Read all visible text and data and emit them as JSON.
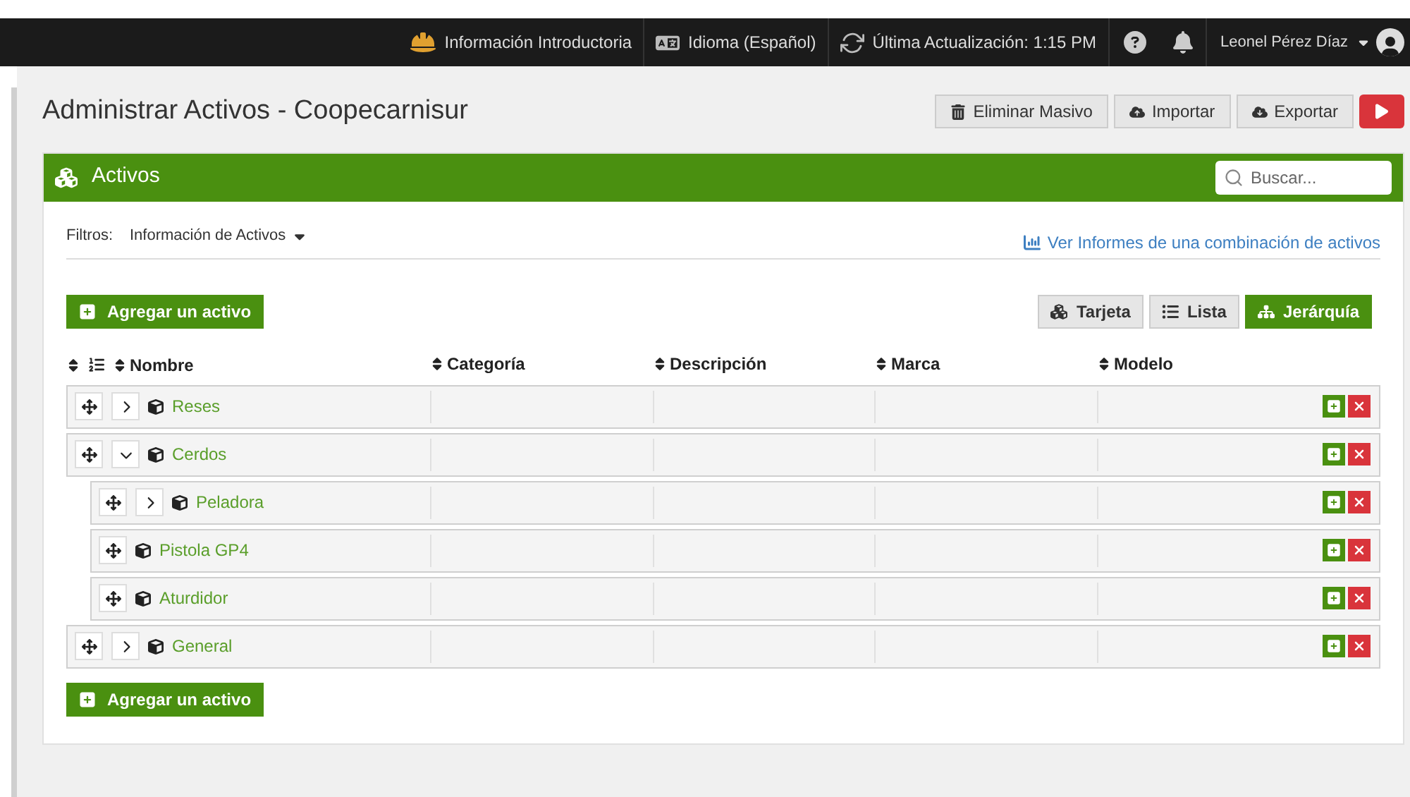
{
  "navbar": {
    "items": [
      "Información Introductoria",
      "Idioma (Español)",
      "Última Actualización: 1:15 PM"
    ],
    "user": "Leonel Pérez Díaz"
  },
  "page": {
    "title": "Administrar Activos - Coopecarnisur",
    "actions": [
      "Eliminar Masivo",
      "Importar",
      "Exportar"
    ]
  },
  "panel": {
    "title": "Activos",
    "search": {
      "placeholder": "Buscar..."
    },
    "filters": {
      "label": "Filtros:",
      "value": "Información de Activos"
    },
    "report_link": "Ver Informes de una combinación de activos",
    "add_button": "Agregar un activo",
    "views": [
      {
        "label": "Tarjeta",
        "selected": false
      },
      {
        "label": "Lista",
        "selected": false
      },
      {
        "label": "Jerárquía",
        "selected": true
      }
    ],
    "columns": [
      "Nombre",
      "Categoría",
      "Descripción",
      "Marca",
      "Modelo"
    ],
    "rows": [
      {
        "name": "Reses",
        "kind": "group",
        "expanded": false
      },
      {
        "name": "Cerdos",
        "kind": "group",
        "expanded": true,
        "children": [
          {
            "name": "Peladora",
            "kind": "group",
            "expanded": false
          },
          {
            "name": "Pistola GP4",
            "kind": "leaf"
          },
          {
            "name": "Aturdidor",
            "kind": "leaf"
          }
        ]
      },
      {
        "name": "General",
        "kind": "group",
        "expanded": false
      }
    ],
    "add_button_bottom": "Agregar un activo"
  }
}
